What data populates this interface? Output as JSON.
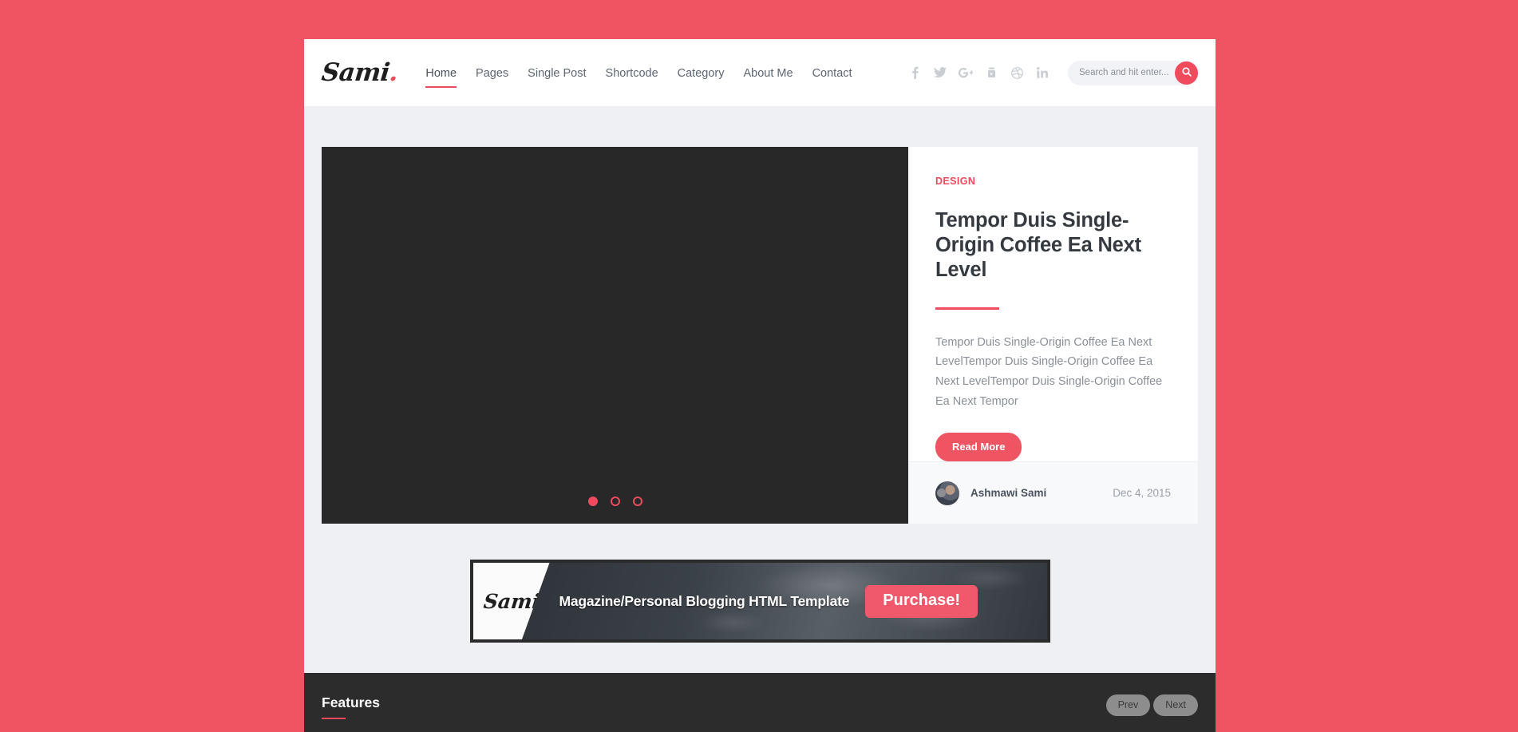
{
  "site": {
    "brand": "Sami",
    "brand_dot": "."
  },
  "nav": {
    "items": [
      {
        "label": "Home",
        "active": true
      },
      {
        "label": "Pages",
        "active": false
      },
      {
        "label": "Single Post",
        "active": false
      },
      {
        "label": "Shortcode",
        "active": false
      },
      {
        "label": "Category",
        "active": false
      },
      {
        "label": "About Me",
        "active": false
      },
      {
        "label": "Contact",
        "active": false
      }
    ]
  },
  "social": {
    "items": [
      {
        "icon": "facebook-icon",
        "title": "Facebook"
      },
      {
        "icon": "twitter-icon",
        "title": "Twitter"
      },
      {
        "icon": "google-plus-icon",
        "title": "Google Plus"
      },
      {
        "icon": "youtube-icon",
        "title": "YouTube"
      },
      {
        "icon": "dribbble-icon",
        "title": "Dribbble"
      },
      {
        "icon": "linkedin-icon",
        "title": "LinkedIn"
      }
    ]
  },
  "search": {
    "placeholder": "Search and hit enter...",
    "value": "",
    "icon": "search-icon"
  },
  "slider": {
    "dots": [
      {
        "active": true
      },
      {
        "active": false
      },
      {
        "active": false
      }
    ],
    "image_background": "#282828"
  },
  "featured_post": {
    "category": "DESIGN",
    "title": "Tempor Duis Single-Origin Coffee Ea Next Level",
    "excerpt": "Tempor Duis Single-Origin Coffee Ea Next LevelTempor Duis Single-Origin Coffee Ea Next LevelTempor Duis Single-Origin Coffee Ea Next Tempor",
    "read_more_label": "Read More",
    "author": "Ashmawi Sami",
    "date": "Dec 4, 2015"
  },
  "promo": {
    "logo": "Sami",
    "logo_dot": ".",
    "tagline": "Magazine/Personal Blogging HTML Template",
    "cta_label": "Purchase!"
  },
  "features": {
    "heading": "Features",
    "prev_label": "Prev",
    "next_label": "Next"
  },
  "colors": {
    "accent": "#ef4b5d",
    "page_background": "#ef5463",
    "content_background": "#eff0f4",
    "dark": "#2c2c2c"
  }
}
